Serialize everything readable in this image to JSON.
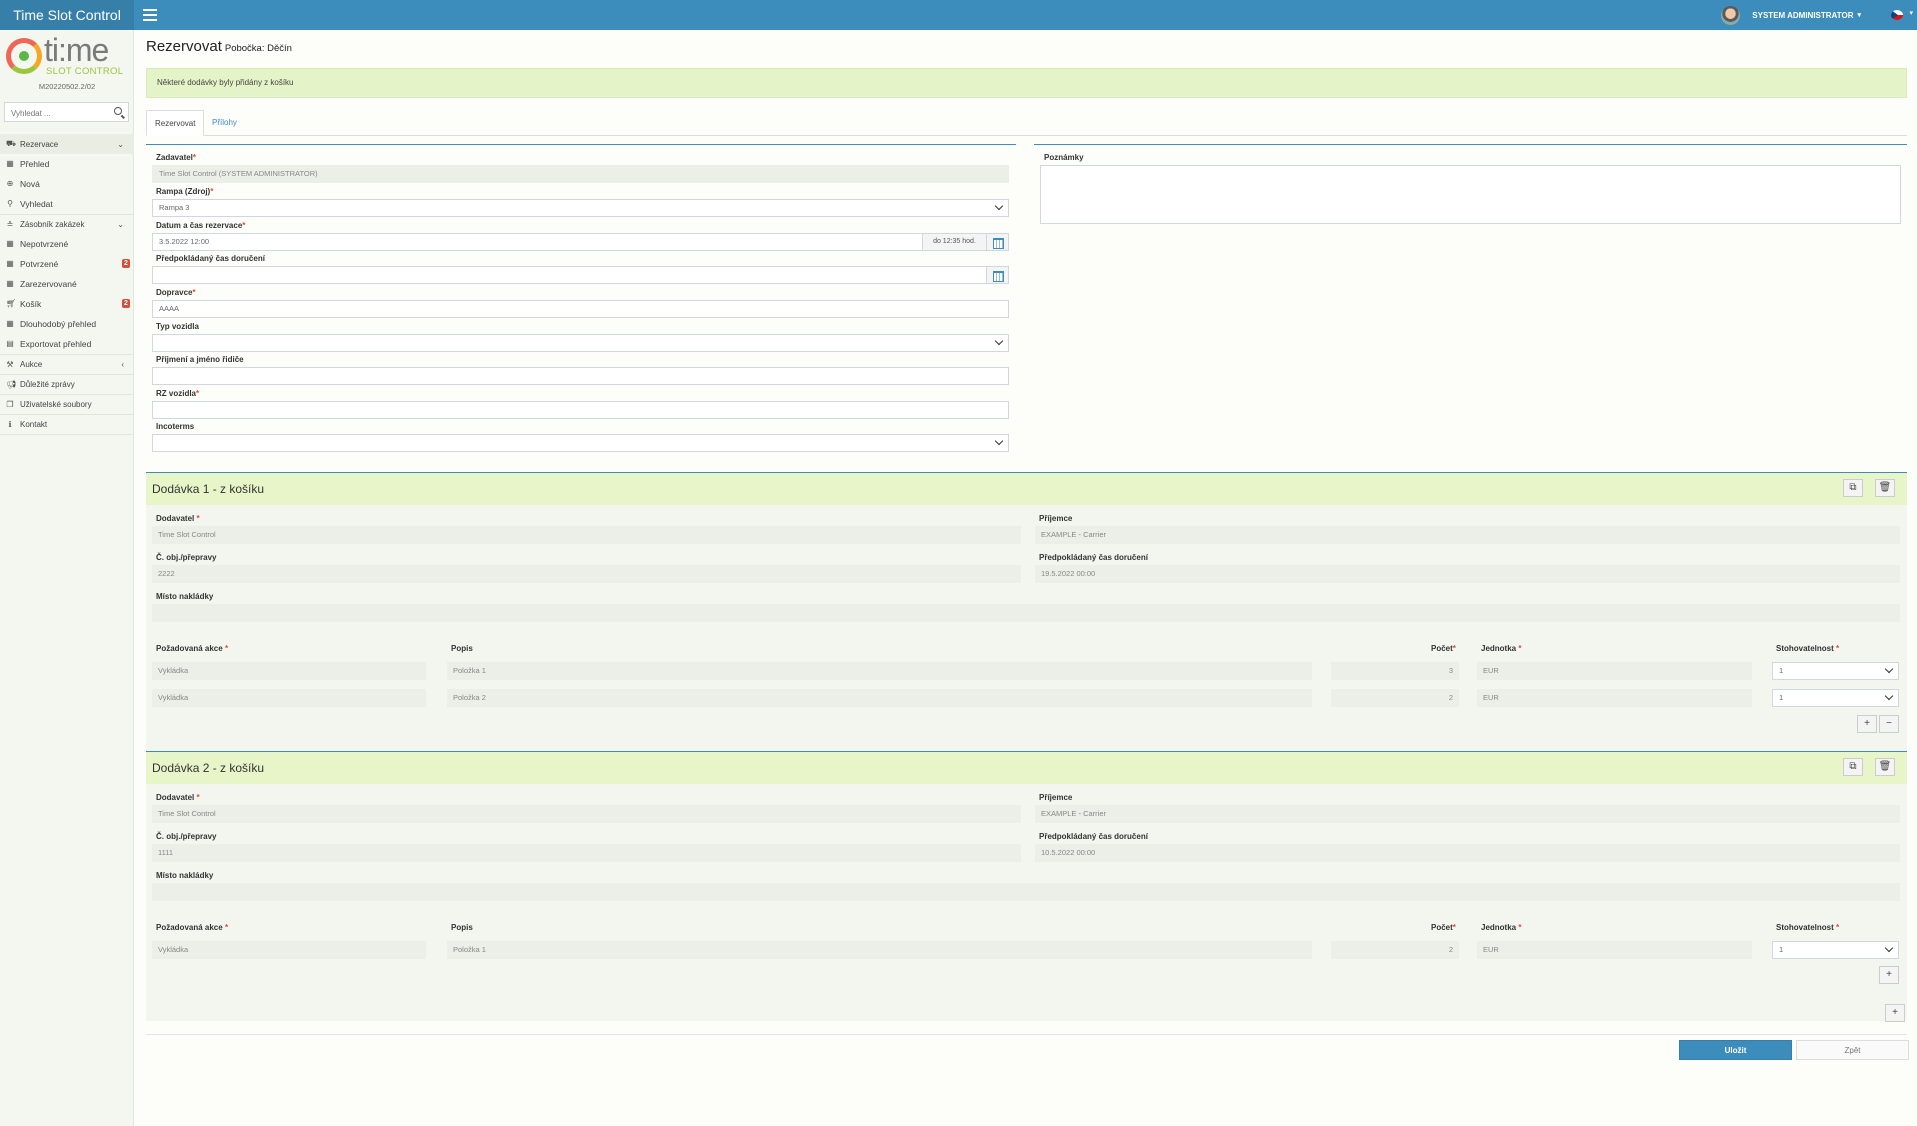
{
  "app": {
    "title": "Time Slot Control",
    "version": "M20220502.2/02",
    "logo_text": "ti:me",
    "logo_sub": "SLOT CONTROL"
  },
  "user": {
    "name": "SYSTEM ADMINISTRATOR",
    "flag_icon": "czech-flag-icon"
  },
  "search": {
    "placeholder": "Vyhledat ..."
  },
  "menu": {
    "rezervace": "Rezervace",
    "prehled": "Přehled",
    "nova": "Nová",
    "vyhledat": "Vyhledat",
    "zasobnik": "Zásobník zakázek",
    "nepotvrzene": "Nepotvrzené",
    "potvrzene": "Potvrzené",
    "potvrzene_badge": "2",
    "zarezervovane": "Zarezervované",
    "kosik": "Košík",
    "kosik_badge": "2",
    "dlouhodoby": "Dlouhodobý přehled",
    "export": "Exportovat přehled",
    "aukce": "Aukce",
    "zpravy": "Důležité zprávy",
    "soubory": "Uživatelské soubory",
    "kontakt": "Kontakt"
  },
  "page": {
    "title": "Rezervovat",
    "subtitle": "Pobočka: Děčín"
  },
  "alert": "Některé dodávky byly přidány z košíku",
  "tabs": {
    "rezervovat": "Rezervovat",
    "prilohy": "Přílohy"
  },
  "form": {
    "zadavatel_label": "Zadavatel",
    "zadavatel_value": "Time Slot Control (SYSTEM ADMINISTRATOR)",
    "rampa_label": "Rampa (Zdroj)",
    "rampa_value": "Rampa 3",
    "datum_label": "Datum a čas rezervace",
    "datum_value": "3.5.2022 12:00",
    "datum_addon": "do 12:35 hod.",
    "predp_label": "Předpokládaný čas doručení",
    "predp_value": "",
    "dopravce_label": "Dopravce",
    "dopravce_value": "AAAA",
    "typ_label": "Typ vozidla",
    "typ_value": "",
    "ridic_label": "Příjmení a jméno řidiče",
    "ridic_value": "",
    "rz_label": "RZ vozidla",
    "rz_value": "",
    "incoterms_label": "Incoterms",
    "incoterms_value": "",
    "poznamky_label": "Poznámky"
  },
  "labels": {
    "dodavatel": "Dodavatel",
    "prijemce": "Příjemce",
    "obj": "Č. obj./přepravy",
    "predp": "Předpokládaný čas doručení",
    "misto": "Místo nakládky",
    "akce": "Požadovaná akce",
    "popis": "Popis",
    "pocet": "Počet",
    "jednotka": "Jednotka",
    "stoh": "Stohovatelnost"
  },
  "shipments": [
    {
      "title": "Dodávka 1 - z košíku",
      "dodavatel": "Time Slot Control",
      "prijemce": "EXAMPLE - Carrier",
      "obj": "2222",
      "predp": "19.5.2022 00:00",
      "misto": "",
      "items": [
        {
          "akce": "Vykládka",
          "popis": "Položka 1",
          "pocet": "3",
          "jednotka": "EUR",
          "stoh": "1"
        },
        {
          "akce": "Vykládka",
          "popis": "Položka 2",
          "pocet": "2",
          "jednotka": "EUR",
          "stoh": "1"
        }
      ]
    },
    {
      "title": "Dodávka 2 - z košíku",
      "dodavatel": "Time Slot Control",
      "prijemce": "EXAMPLE - Carrier",
      "obj": "1111",
      "predp": "10.5.2022 00:00",
      "misto": "",
      "items": [
        {
          "akce": "Vykládka",
          "popis": "Položka 1",
          "pocet": "2",
          "jednotka": "EUR",
          "stoh": "1"
        }
      ]
    }
  ],
  "buttons": {
    "save": "Uložit",
    "back": "Zpět"
  },
  "colors": {
    "primary": "#3c8dbc",
    "alert_bg": "#e4f4c8",
    "badge": "#dd4b39"
  }
}
